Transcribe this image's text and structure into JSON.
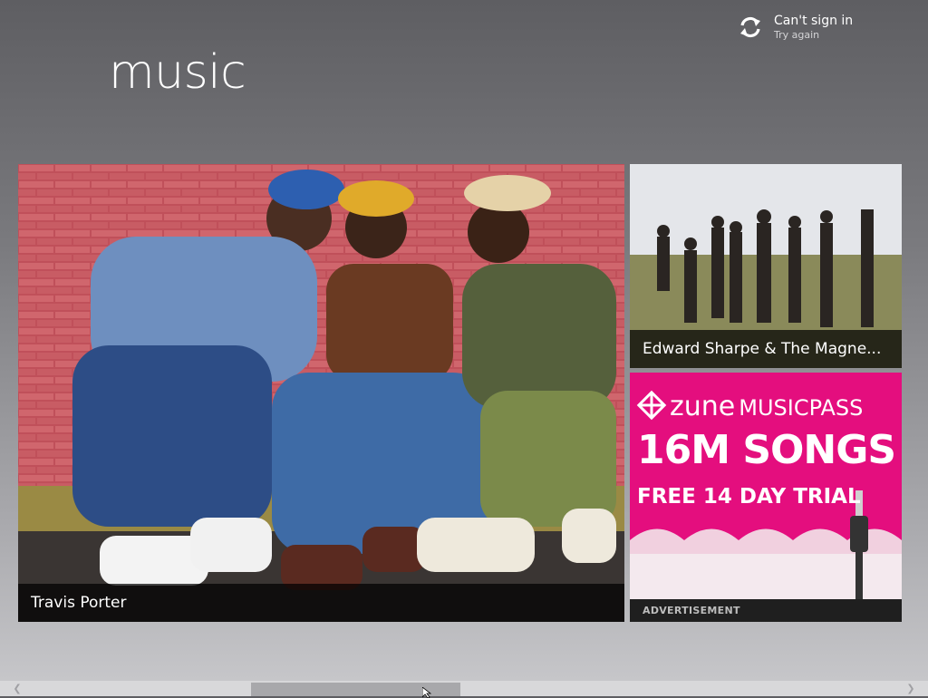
{
  "app": {
    "title": "music"
  },
  "account": {
    "status": "Can't sign in",
    "action": "Try again",
    "icon": "sync-icon"
  },
  "tiles": {
    "featured": {
      "caption": "Travis Porter"
    },
    "secondary": {
      "caption": "Edward Sharpe & The Magne..."
    },
    "ad": {
      "brand": "zune",
      "product": "MUSICPASS",
      "headline": "16M SONGS",
      "offer": "FREE 14 DAY TRIAL",
      "label": "ADVERTISEMENT"
    }
  },
  "colors": {
    "ad_magenta": "#e40e7e",
    "hero_bg": "#b84550",
    "caption_bg": "#000000"
  }
}
